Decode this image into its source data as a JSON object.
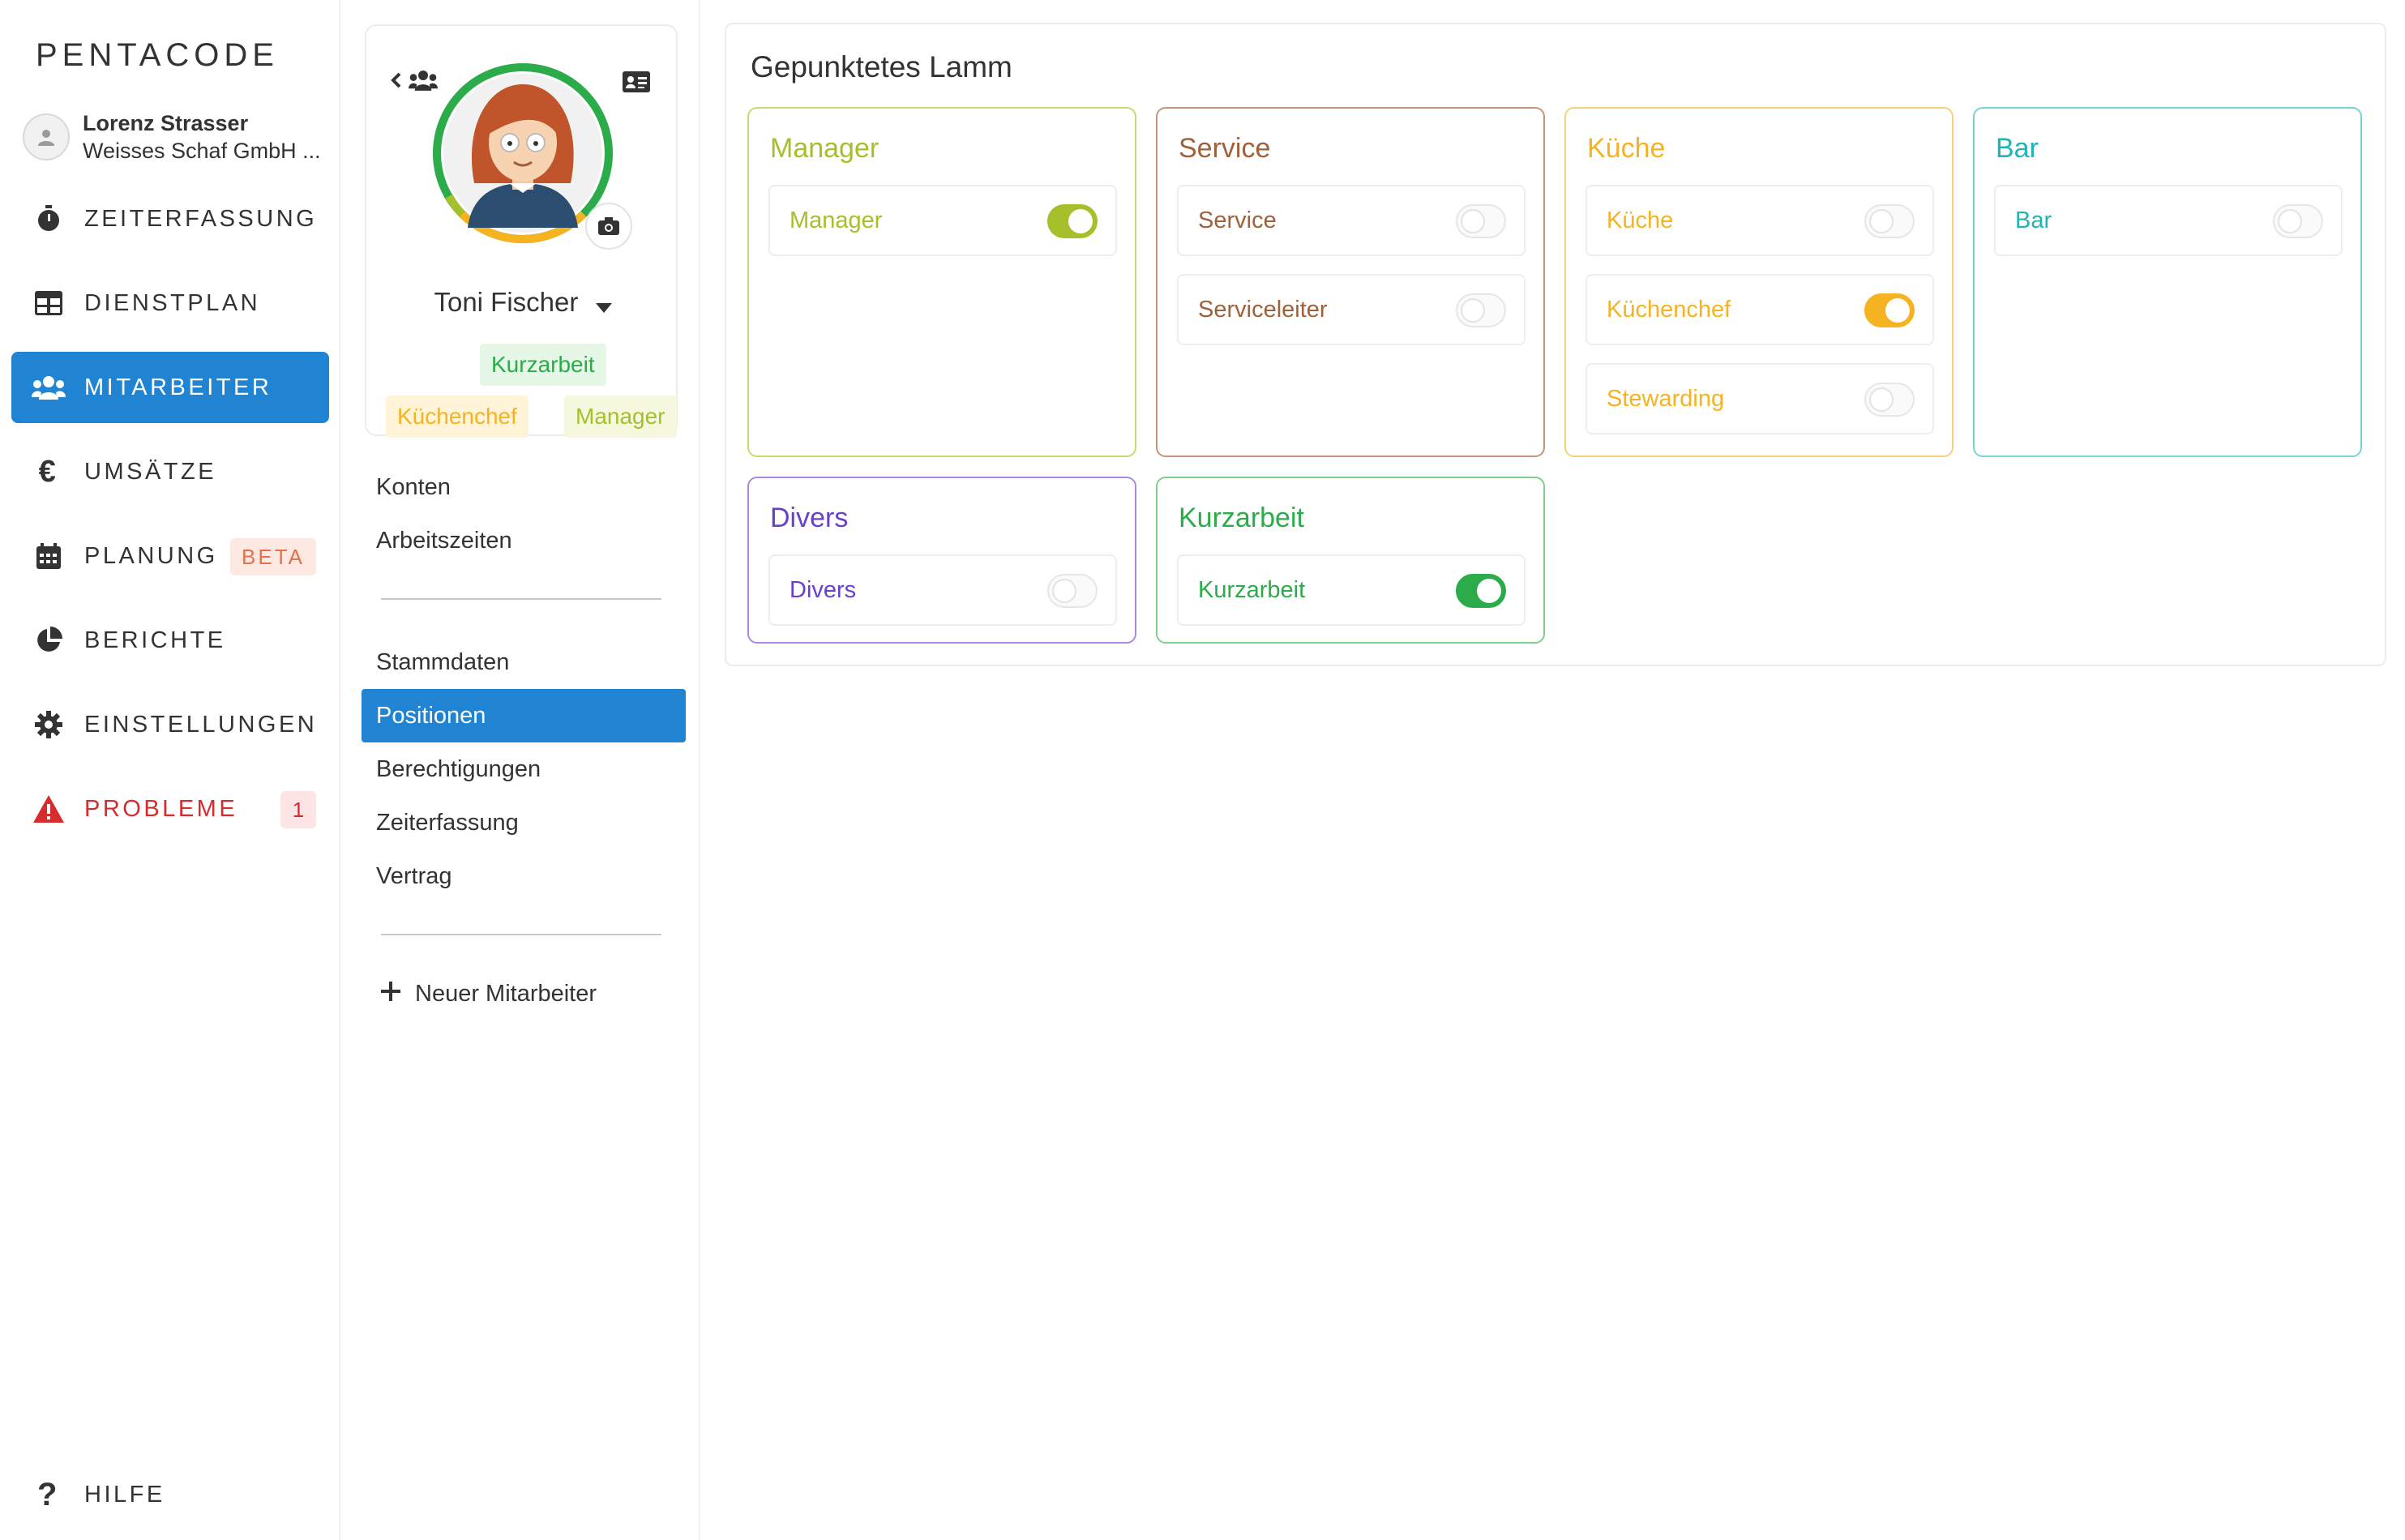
{
  "app": {
    "logo": "PENTACODE"
  },
  "user": {
    "name": "Lorenz Strasser",
    "company": "Weisses Schaf GmbH ..."
  },
  "nav": {
    "items": [
      {
        "label": "ZEITERFASSUNG",
        "icon": "stopwatch-icon"
      },
      {
        "label": "DIENSTPLAN",
        "icon": "table-icon"
      },
      {
        "label": "MITARBEITER",
        "icon": "users-icon",
        "active": true
      },
      {
        "label": "UMSÄTZE",
        "icon": "euro-icon"
      },
      {
        "label": "PLANUNG",
        "icon": "calendar-icon",
        "badge": "BETA"
      },
      {
        "label": "BERICHTE",
        "icon": "pie-chart-icon"
      },
      {
        "label": "EINSTELLUNGEN",
        "icon": "gear-icon"
      },
      {
        "label": "PROBLEME",
        "icon": "warning-icon",
        "badge": "1"
      }
    ],
    "help": "HILFE"
  },
  "profile": {
    "name": "Toni Fischer",
    "tags": [
      "Kurzarbeit",
      "Küchenchef",
      "Manager"
    ]
  },
  "sections": {
    "group1": [
      "Konten",
      "Arbeitszeiten"
    ],
    "group2": [
      "Stammdaten",
      "Positionen",
      "Berechtigungen",
      "Zeiterfassung",
      "Vertrag"
    ],
    "active": "Positionen",
    "new_employee": "Neuer Mitarbeiter"
  },
  "positions": {
    "location": "Gepunktetes Lamm",
    "groups": [
      {
        "title": "Manager",
        "color": "#a5c02a",
        "items": [
          {
            "label": "Manager",
            "on": true
          }
        ]
      },
      {
        "title": "Service",
        "color": "#a0603a",
        "items": [
          {
            "label": "Service",
            "on": false
          },
          {
            "label": "Serviceleiter",
            "on": false
          }
        ]
      },
      {
        "title": "Küche",
        "color": "#f5b321",
        "items": [
          {
            "label": "Küche",
            "on": false
          },
          {
            "label": "Küchenchef",
            "on": true
          },
          {
            "label": "Stewarding",
            "on": false
          }
        ]
      },
      {
        "title": "Bar",
        "color": "#1fb5b5",
        "items": [
          {
            "label": "Bar",
            "on": false
          }
        ]
      },
      {
        "title": "Divers",
        "color": "#6a3fce",
        "items": [
          {
            "label": "Divers",
            "on": false
          }
        ]
      },
      {
        "title": "Kurzarbeit",
        "color": "#2cab4b",
        "items": [
          {
            "label": "Kurzarbeit",
            "on": true
          }
        ]
      }
    ]
  }
}
